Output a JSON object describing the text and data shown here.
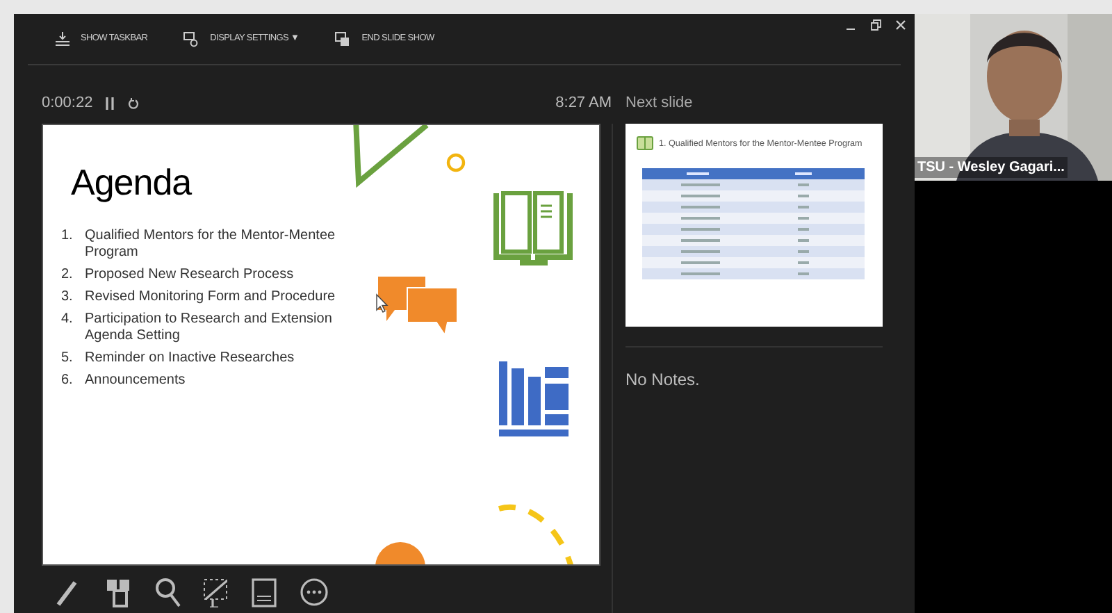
{
  "toolbar": {
    "buttons": [
      {
        "label": "SHOW TASKBAR",
        "kind": "taskbar"
      },
      {
        "label": "DISPLAY SETTINGS",
        "kind": "display",
        "caret": "▼"
      },
      {
        "label": "END SLIDE SHOW",
        "kind": "end"
      }
    ]
  },
  "timer": {
    "elapsed": "0:00:22",
    "clock": "8:27 AM"
  },
  "slide": {
    "title": "Agenda",
    "items": [
      {
        "number": "1.",
        "text": "Qualified Mentors for the Mentor-Mentee Program"
      },
      {
        "number": "2.",
        "text": "Proposed New Research Process"
      },
      {
        "number": "3.",
        "text": "Revised Monitoring Form and Procedure"
      },
      {
        "number": "4.",
        "text": "Participation to Research and Extension Agenda Setting"
      },
      {
        "number": "5.",
        "text": "Reminder on Inactive Researches"
      },
      {
        "number": "6.",
        "text": "Announcements"
      }
    ]
  },
  "next_slide": {
    "heading": "Next slide",
    "title": "1. Qualified Mentors for the Mentor-Mentee Program"
  },
  "notes": {
    "text": "No Notes."
  },
  "tools": [
    {
      "kind": "pen"
    },
    {
      "kind": "slides"
    },
    {
      "kind": "zoom"
    },
    {
      "kind": "screen"
    },
    {
      "kind": "subtitles"
    },
    {
      "kind": "more"
    }
  ],
  "video": {
    "kind": "picture",
    "name": "TSU - Wesley Gagari..."
  }
}
